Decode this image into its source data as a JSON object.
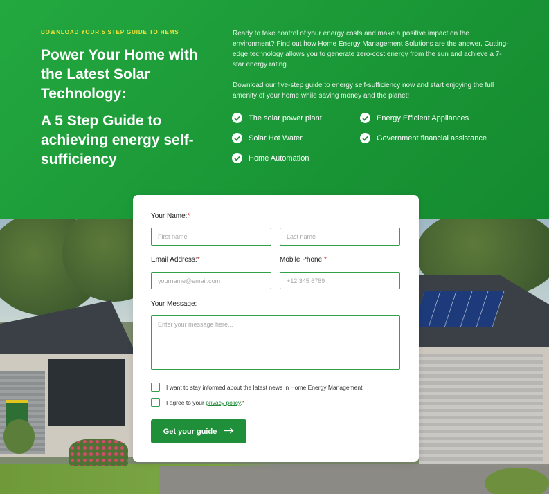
{
  "hero": {
    "eyebrow": "DOWNLOAD YOUR 5 STEP GUIDE TO HEMS",
    "title_line1": "Power Your Home with the Latest Solar Technology:",
    "title_line2": "A 5 Step Guide to achieving energy self-sufficiency",
    "paragraph1": "Ready to take control of your energy costs and make a positive impact on the environment? Find out how Home Energy Management Solutions are the answer. Cutting-edge technology allows you to generate zero-cost energy from the sun and achieve a 7-star energy rating.",
    "paragraph2": "Download our five-step guide to energy self-sufficiency now and start enjoying the full amenity of your home while saving money and the planet!",
    "features": [
      "The solar power plant",
      "Energy Efficient Appliances",
      "Solar Hot Water",
      "Government financial assistance",
      "Home Automation"
    ]
  },
  "form": {
    "name_label": "Your Name:",
    "required_mark": "*",
    "first_name_placeholder": "First name",
    "last_name_placeholder": "Last name",
    "email_label": "Email Address:",
    "email_placeholder": "yourname@email.com",
    "phone_label": "Mobile Phone:",
    "phone_placeholder": "+12 345 6789",
    "message_label": "Your Message:",
    "message_placeholder": "Enter your message here...",
    "newsletter_text": "I want to stay informed about the latest news in Home Energy Management",
    "privacy_prefix": "I agree to your ",
    "privacy_link": "privacy policy",
    "privacy_suffix": ".",
    "submit_label": "Get your guide"
  },
  "colors": {
    "brand_green": "#1f8f3a",
    "eyebrow_yellow": "#f2e33c",
    "required_red": "#d0342c"
  },
  "icons": {
    "feature_check": "check-circle-icon",
    "submit_arrow": "arrow-right-icon"
  }
}
